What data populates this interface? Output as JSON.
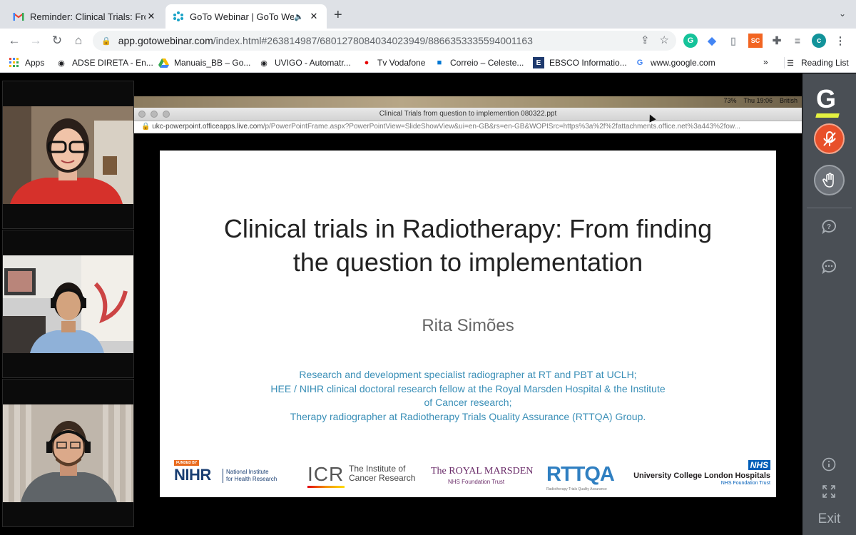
{
  "browser": {
    "tabs": [
      {
        "title": "Reminder: Clinical Trials: From",
        "favicon": "gmail-icon",
        "active": false
      },
      {
        "title": "GoTo Webinar | GoTo Webin",
        "favicon": "gotowebinar-icon",
        "active": true
      }
    ],
    "url_host": "app.gotowebinar.com",
    "url_path": "/index.html#263814987/6801278084034023949/8866353335594001163",
    "bookmarks": [
      {
        "label": "Apps",
        "icon": "apps-grid-icon"
      },
      {
        "label": "ADSE DIRETA - En...",
        "icon": "globe-icon"
      },
      {
        "label": "Manuais_BB – Go...",
        "icon": "google-drive-icon"
      },
      {
        "label": "UVIGO - Automatr...",
        "icon": "globe-icon"
      },
      {
        "label": "Tv Vodafone",
        "icon": "vodafone-icon"
      },
      {
        "label": "Correio – Celeste...",
        "icon": "outlook-icon"
      },
      {
        "label": "EBSCO Informatio...",
        "icon": "ebsco-icon"
      },
      {
        "label": "www.google.com",
        "icon": "google-icon"
      }
    ],
    "reading_list": "Reading List",
    "more_bookmarks": "»",
    "profile_initial": "c"
  },
  "shared_screen": {
    "mac_status": {
      "battery": "73%",
      "time": "Thu 19:06",
      "language": "British"
    },
    "window_title": "Clinical Trials from question to implemention 080322.ppt",
    "url_host": "ukc-powerpoint.officeapps.live.com",
    "url_rest": "/p/PowerPointFrame.aspx?PowerPointView=SlideShowView&ui=en-GB&rs=en-GB&WOPISrc=https%3a%2f%2fattachments.office.net%3a443%2fow...",
    "slide": {
      "title_line1": "Clinical trials in Radiotherapy: From finding",
      "title_line2": "the question to implementation",
      "author": "Rita Simões",
      "desc_lines": [
        "Research and development specialist radiographer at RT and PBT at UCLH;",
        "HEE / NIHR clinical doctoral research fellow at the Royal Marsden Hospital & the Institute",
        "of Cancer research;",
        "Therapy radiographer at Radiotherapy Trials Quality Assurance (RTTQA) Group."
      ],
      "logos": {
        "nihr_funded": "FUNDED BY",
        "nihr_mark": "NIHR",
        "nihr_name1": "National Institute",
        "nihr_name2": "for Health Research",
        "icr_mark": "ICR",
        "icr_name1": "The Institute of",
        "icr_name2": "Cancer Research",
        "rm_name": "The ROYAL MARSDEN",
        "rm_sub": "NHS Foundation Trust",
        "rttqa_mark": "RTTQA",
        "rttqa_sub": "Radiotherapy Trials Quality Assurance",
        "nhs_mark": "NHS",
        "uclh_name": "University College London Hospitals",
        "uclh_sub": "NHS Foundation Trust"
      }
    }
  },
  "sidebar": {
    "logo": "G",
    "exit_label": "Exit"
  },
  "colors": {
    "mic_button": "#e8502a",
    "sidebar": "#4a4f55",
    "slide_desc": "#3a8fb7",
    "gotowebinar_accent": "#e5f240"
  }
}
